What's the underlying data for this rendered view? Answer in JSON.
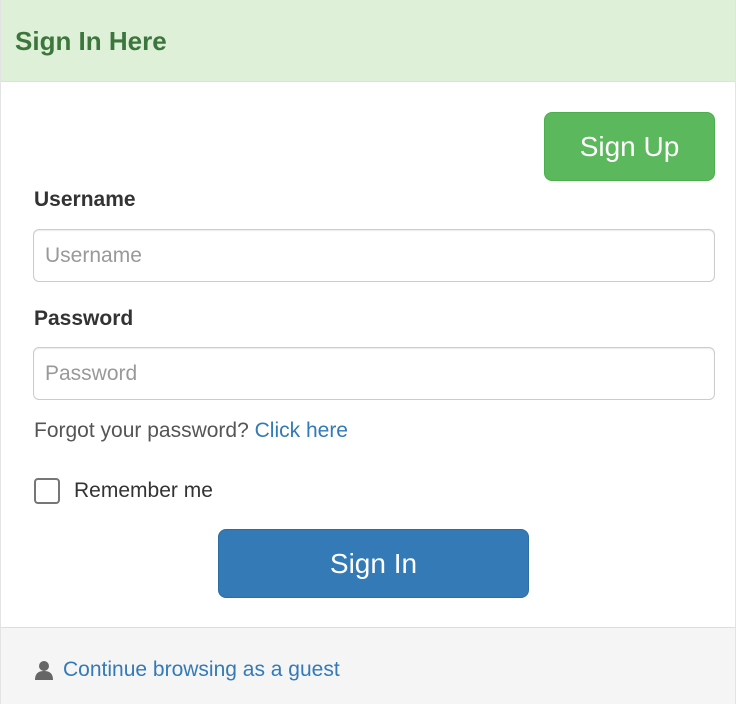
{
  "heading": {
    "title": "Sign In Here"
  },
  "signup": {
    "label": "Sign Up"
  },
  "username": {
    "label": "Username",
    "placeholder": "Username",
    "value": ""
  },
  "password": {
    "label": "Password",
    "placeholder": "Password",
    "value": ""
  },
  "forgot": {
    "text": "Forgot your password?",
    "link": "Click here"
  },
  "remember": {
    "label": "Remember me",
    "checked": false
  },
  "signin": {
    "label": "Sign In"
  },
  "footer": {
    "icon": "user-icon",
    "guest_link": "Continue browsing as a guest"
  },
  "colors": {
    "heading_bg": "#dff0d8",
    "heading_text": "#3c763d",
    "signup_button": "#5cb85c",
    "signin_button": "#337ab7",
    "link": "#337ab7",
    "footer_bg": "#f5f5f5"
  }
}
